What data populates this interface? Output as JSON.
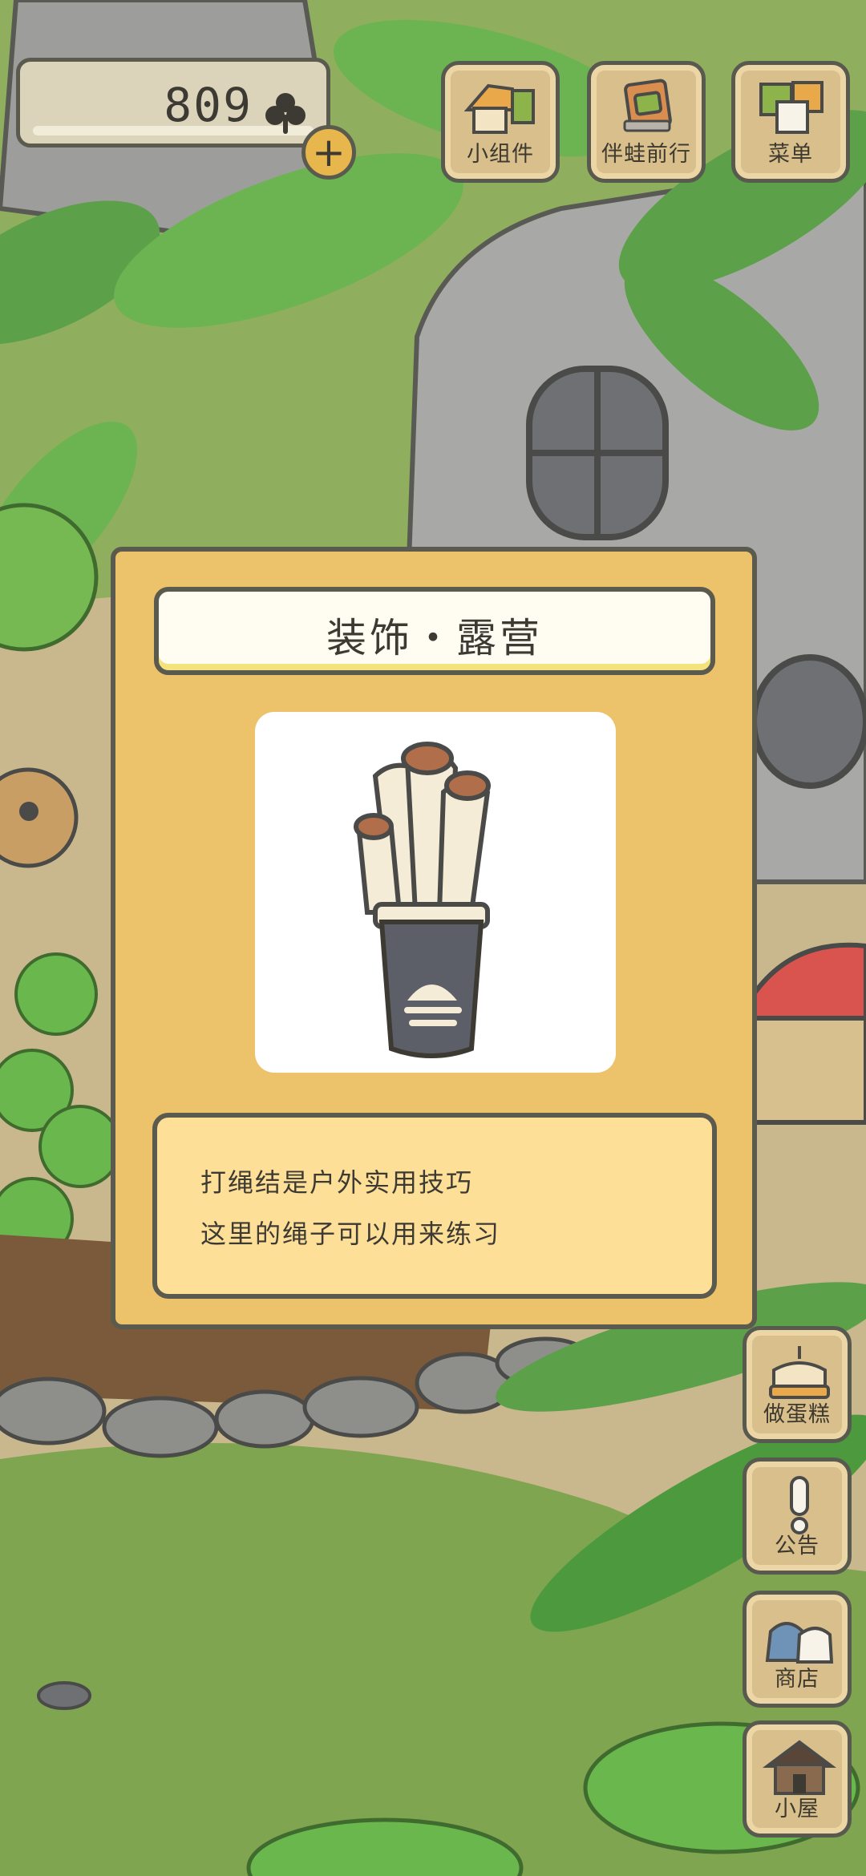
{
  "currency": {
    "clover_count": "809",
    "icon": "clover-icon",
    "add_icon": "plus-icon",
    "add_label": "+"
  },
  "top_buttons": [
    {
      "label": "小组件",
      "icon": "widget-icon"
    },
    {
      "label": "伴蛙前行",
      "icon": "frog-companion-icon"
    },
    {
      "label": "菜单",
      "icon": "menu-icon"
    }
  ],
  "dialog": {
    "title": "装饰・露营",
    "item_icon": "rope-bundle-icon",
    "description_lines": [
      "打绳结是户外实用技巧",
      "这里的绳子可以用来练习"
    ]
  },
  "side_buttons": [
    {
      "label": "做蛋糕",
      "icon": "cake-icon"
    },
    {
      "label": "公告",
      "icon": "exclamation-icon"
    },
    {
      "label": "商店",
      "icon": "shop-bags-icon"
    },
    {
      "label": "小屋",
      "icon": "house-icon"
    }
  ],
  "colors": {
    "dialog_bg": "#ecc26b",
    "outline": "#5b5a4f",
    "desc_bg": "#fedf98",
    "button_wood": "#d8bf8b"
  }
}
